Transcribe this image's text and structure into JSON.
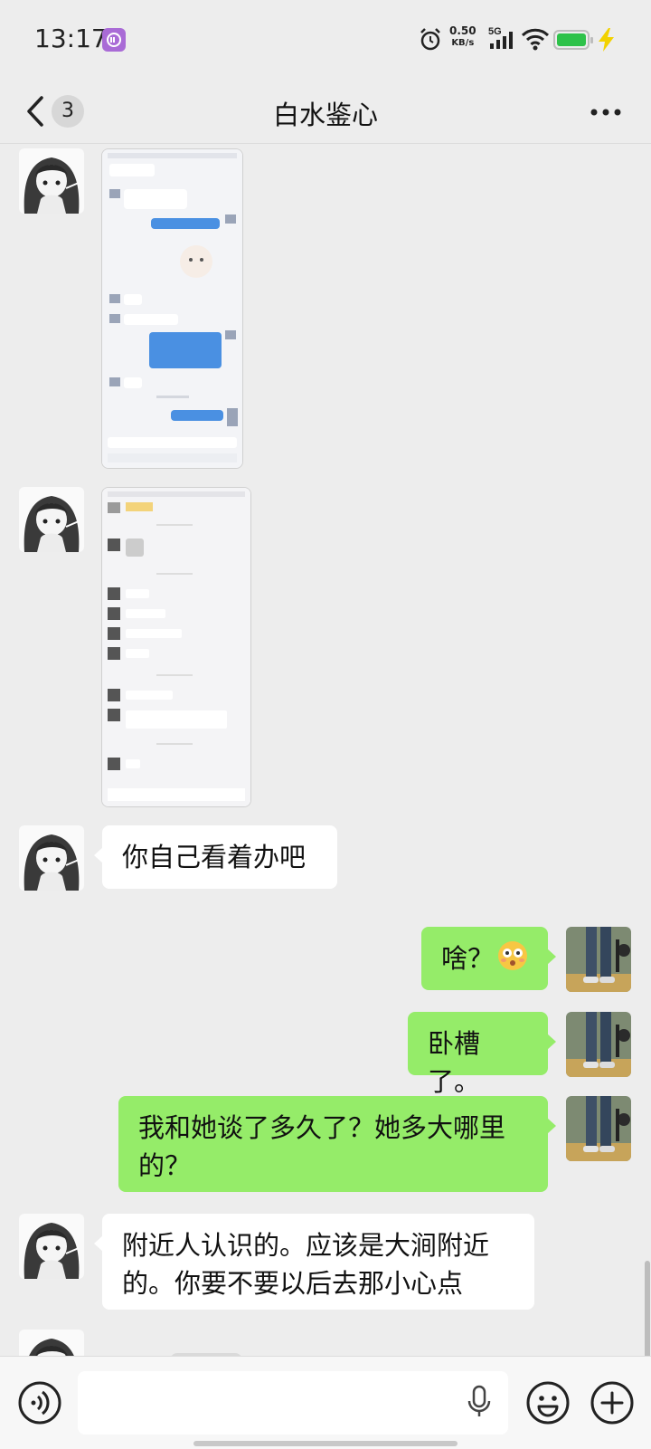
{
  "status_bar": {
    "time": "13:17",
    "net_speed_value": "0.50",
    "net_speed_unit": "KB/s",
    "network_type": "5G",
    "battery_color": "#2ec24a"
  },
  "header": {
    "unread_count": "3",
    "title": "白水鉴心"
  },
  "messages": [
    {
      "side": "in",
      "kind": "image",
      "content": "screenshot-of-chat"
    },
    {
      "side": "in",
      "kind": "image",
      "content": "screenshot-of-chat"
    },
    {
      "side": "in",
      "kind": "text",
      "text": "你自己看着办吧"
    },
    {
      "side": "out",
      "kind": "text",
      "text": "啥？",
      "emoji": "flushed-face"
    },
    {
      "side": "out",
      "kind": "text",
      "text": "卧槽了。"
    },
    {
      "side": "out",
      "kind": "text",
      "text": "我和她谈了多久了？她多大哪里的？"
    },
    {
      "side": "in",
      "kind": "text",
      "text": "附近人认识的。应该是大涧附近的。你要不要以后去那小心点"
    }
  ],
  "input_bar": {
    "placeholder": "",
    "icons": [
      "voice-mode-icon",
      "microphone-icon",
      "emoji-icon",
      "plus-icon"
    ]
  },
  "colors": {
    "background": "#ededed",
    "outgoing_bubble": "#95ec69",
    "incoming_bubble": "#ffffff"
  }
}
